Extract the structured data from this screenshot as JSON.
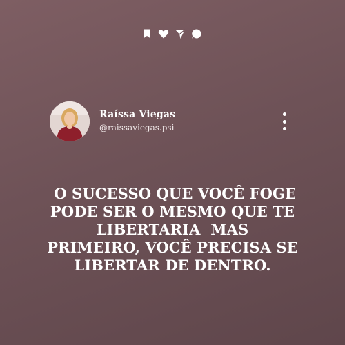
{
  "top_icons": [
    {
      "name": "bookmark-icon"
    },
    {
      "name": "heart-icon"
    },
    {
      "name": "send-icon"
    },
    {
      "name": "comment-icon"
    }
  ],
  "post": {
    "author_name": "Raíssa Viegas",
    "author_handle": "@raissaviegas.psi",
    "more_icon": "more-vertical-icon",
    "quote_lines": [
      " O SUCESSO QUE VOCÊ FOGE",
      "PODE SER O MESMO QUE TE",
      "LIBERTARIA  MAS",
      "PRIMEIRO, VOCÊ PRECISA SE",
      "LIBERTAR DE DENTRO."
    ]
  },
  "colors": {
    "background": "#6e5257",
    "text": "#ffffff"
  }
}
